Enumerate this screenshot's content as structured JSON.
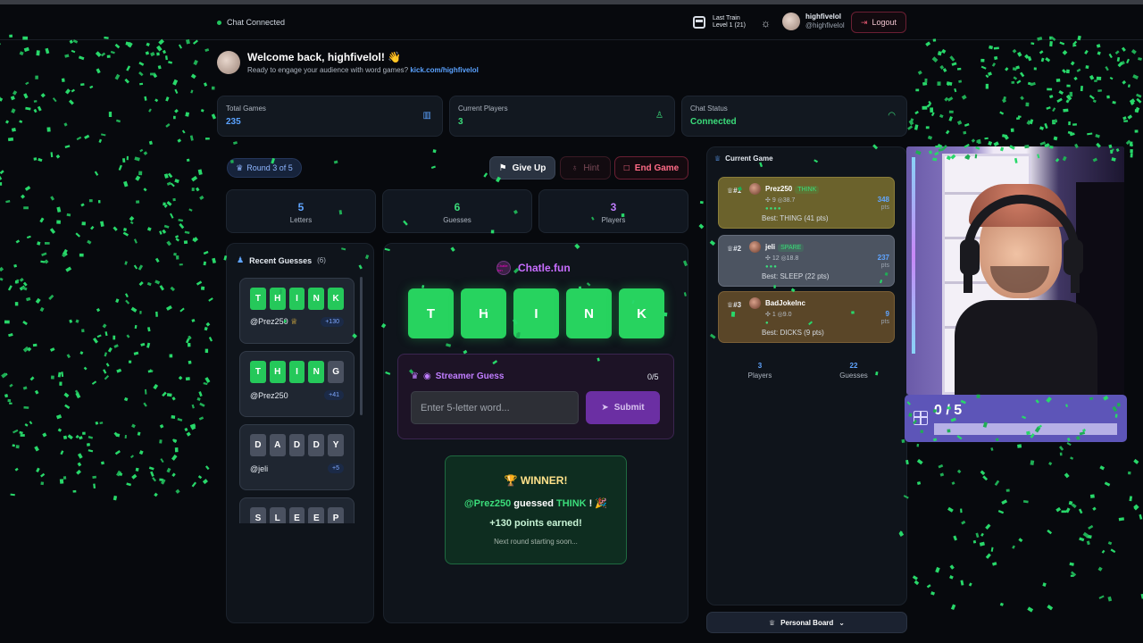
{
  "topbar": {
    "chat_status": "Chat Connected",
    "last_train_line1": "Last Train",
    "last_train_line2": "Level 1 (21)",
    "user_name": "highfivelol",
    "user_handle": "@highfivelol",
    "logout_label": "Logout"
  },
  "welcome": {
    "title": "Welcome back, highfivelol! 👋",
    "subtitle": "Ready to engage your audience with word games?",
    "link": "kick.com/highfivelol"
  },
  "stats": [
    {
      "label": "Total Games",
      "value": "235",
      "color": "#5aa2ff"
    },
    {
      "label": "Current Players",
      "value": "3",
      "color": "#3bdc7a"
    },
    {
      "label": "Chat Status",
      "value": "Connected",
      "color": "#3bdc7a"
    }
  ],
  "game": {
    "round_label": "Round 3 of 5",
    "give_up": "Give Up",
    "hint": "Hint",
    "end_game": "End Game",
    "mini": [
      {
        "value": "5",
        "label": "Letters",
        "color": "#60a5ff"
      },
      {
        "value": "6",
        "label": "Guesses",
        "color": "#3bdc7a"
      },
      {
        "value": "3",
        "label": "Players",
        "color": "#c07dff"
      }
    ]
  },
  "recent": {
    "title": "Recent Guesses",
    "count": "(6)",
    "items": [
      {
        "letters": [
          "T",
          "H",
          "I",
          "N",
          "K"
        ],
        "correct": [
          true,
          true,
          true,
          true,
          true
        ],
        "user": "@Prez250",
        "trophy": true,
        "points": "+130"
      },
      {
        "letters": [
          "T",
          "H",
          "I",
          "N",
          "G"
        ],
        "correct": [
          true,
          true,
          true,
          true,
          false
        ],
        "user": "@Prez250",
        "trophy": false,
        "points": "+41"
      },
      {
        "letters": [
          "D",
          "A",
          "D",
          "D",
          "Y"
        ],
        "correct": [
          false,
          false,
          false,
          false,
          false
        ],
        "user": "@jeli",
        "trophy": false,
        "points": "+5"
      },
      {
        "letters": [
          "S",
          "L",
          "E",
          "E",
          "P"
        ],
        "correct": [
          false,
          false,
          false,
          false,
          false
        ],
        "user": "",
        "trophy": false,
        "points": ""
      }
    ]
  },
  "board": {
    "brand": "Chatle.fun",
    "brand_logo": "Chatle fun",
    "word": [
      "T",
      "H",
      "I",
      "N",
      "K"
    ]
  },
  "streamer": {
    "title": "Streamer Guess",
    "count": "0/5",
    "placeholder": "Enter 5-letter word...",
    "submit": "Submit"
  },
  "winner": {
    "title": "WINNER!",
    "user": "@Prez250",
    "guessed": "guessed",
    "word": "THINK",
    "points": "+130 points earned!",
    "next": "Next round starting soon..."
  },
  "current_game": {
    "title": "Current Game",
    "players": [
      {
        "rank": "#1",
        "name": "Prez250",
        "tag": "THINK",
        "stat": "9 ◎38.7",
        "best": "Best: THING (41 pts)",
        "points": "348",
        "pts_label": "pts",
        "dots": "●●●●"
      },
      {
        "rank": "#2",
        "name": "jeli",
        "tag": "SPARE",
        "stat": "12 ◎18.8",
        "best": "Best: SLEEP (22 pts)",
        "points": "237",
        "pts_label": "pts",
        "dots": "●●●"
      },
      {
        "rank": "#3",
        "name": "BadJokeInc",
        "tag": "",
        "stat": "1 ◎9.0",
        "best": "Best: DICKS (9 pts)",
        "points": "9",
        "pts_label": "pts",
        "dots": "●"
      }
    ],
    "players_count": "3",
    "players_label": "Players",
    "guesses_count": "22",
    "guesses_label": "Guesses"
  },
  "personal_board": "Personal Board",
  "overlay": {
    "counter": "0 / 5",
    "progress": 0
  },
  "colors": {
    "accent_green": "#27d35f",
    "accent_purple": "#c07dff",
    "accent_blue": "#5aa2ff",
    "danger": "#ff6b86"
  }
}
